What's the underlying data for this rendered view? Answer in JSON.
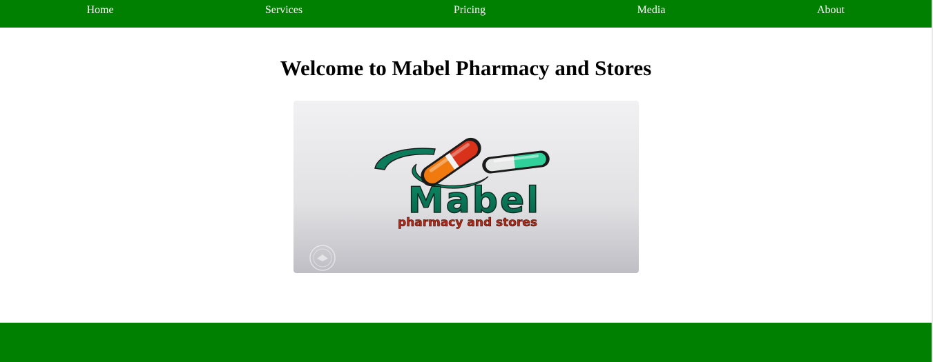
{
  "nav": {
    "items": [
      {
        "label": "Home"
      },
      {
        "label": "Services"
      },
      {
        "label": "Pricing"
      },
      {
        "label": "Media"
      },
      {
        "label": "About"
      }
    ]
  },
  "main": {
    "heading": "Welcome to Mabel Pharmacy and Stores"
  },
  "logo": {
    "brand": "Mabel",
    "tagline": "pharmacy and stores"
  },
  "colors": {
    "nav_bg": "#008000",
    "footer_bg": "#008000",
    "brand_green": "#0a7a58",
    "tagline_red": "#b52a17"
  }
}
